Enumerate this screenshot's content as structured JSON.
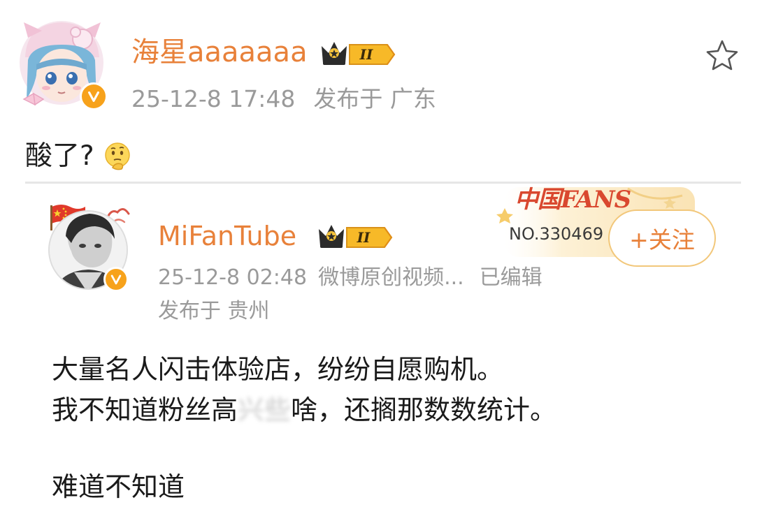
{
  "post": {
    "author": "海星aaaaaaa",
    "vip_level": "II",
    "time": "25-12-8 17:48",
    "location": "发布于 广东",
    "text": "酸了?",
    "emoji": "thinking-emoji"
  },
  "repost": {
    "author": "MiFanTube",
    "vip_level": "II",
    "fans_logo": "中国FANS",
    "fans_number": "NO.330469",
    "follow_label": "+关注",
    "time": "25-12-8 02:48",
    "source": "微博原创视频...",
    "edited": "已编辑",
    "location": "发布于 贵州",
    "lines": [
      "大量名人闪击体验店，纷纷自愿购机。",
      "我不知道粉丝高",
      "啥，还搁那数数统计。",
      "难道不知道"
    ],
    "blurred_text": "兴些"
  },
  "icons": {
    "favorite": "star-outline-icon",
    "verified": "verified-v-icon",
    "flag": "china-flag-icon"
  },
  "colors": {
    "username": "#e8813a",
    "meta": "#9a9a9a",
    "verified_badge": "#f7a21b",
    "fans_red": "#d9482f"
  }
}
